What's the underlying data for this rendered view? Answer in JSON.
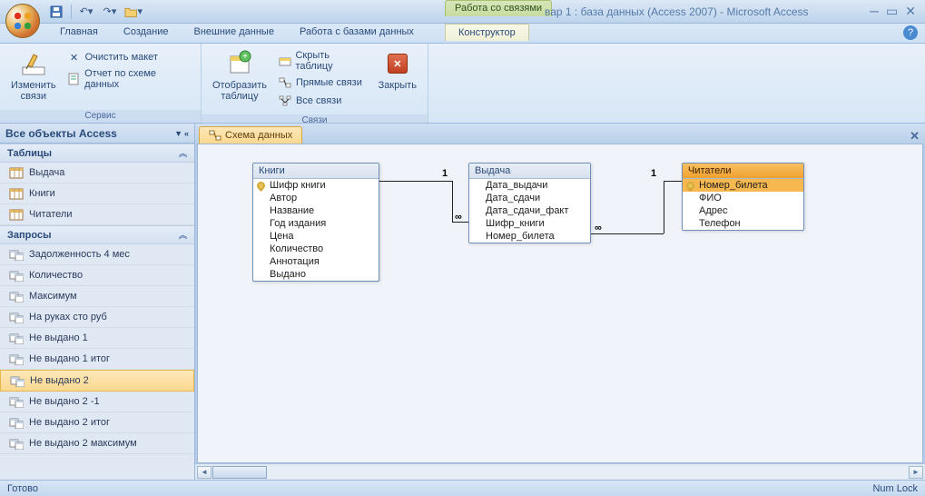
{
  "titlebar": {
    "context_label": "Работа со связями",
    "title": "вар 1 : база данных (Access 2007) - Microsoft Access"
  },
  "tabs": {
    "home": "Главная",
    "create": "Создание",
    "external": "Внешние данные",
    "dbtools": "Работа с базами данных",
    "context": "Конструктор"
  },
  "ribbon": {
    "group_service": "Сервис",
    "group_links": "Связи",
    "edit_links": "Изменить\nсвязи",
    "clear_layout": "Очистить макет",
    "report": "Отчет по схеме данных",
    "show_table": "Отобразить\nтаблицу",
    "hide_table": "Скрыть таблицу",
    "direct_links": "Прямые связи",
    "all_links": "Все связи",
    "close": "Закрыть"
  },
  "navpane": {
    "header": "Все объекты Access",
    "group_tables": "Таблицы",
    "group_queries": "Запросы",
    "tables": [
      "Выдача",
      "Книги",
      "Читатели"
    ],
    "queries": [
      "Задолженность 4 мес",
      "Количество",
      "Максимум",
      "На руках сто руб",
      "Не выдано 1",
      "Не выдано 1 итог",
      "Не выдано 2",
      "Не выдано 2 -1",
      "Не выдано 2 итог",
      "Не выдано 2 максимум"
    ],
    "selected_query": "Не выдано 2"
  },
  "doc": {
    "tab": "Схема данных"
  },
  "diagram": {
    "books": {
      "title": "Книги",
      "fields": [
        "Шифр книги",
        "Автор",
        "Название",
        "Год издания",
        "Цена",
        "Количество",
        "Аннотация",
        "Выдано"
      ],
      "pk": 0
    },
    "issue": {
      "title": "Выдача",
      "fields": [
        "Дата_выдачи",
        "Дата_сдачи",
        "Дата_сдачи_факт",
        "Шифр_книги",
        "Номер_билета"
      ]
    },
    "readers": {
      "title": "Читатели",
      "fields": [
        "Номер_билета",
        "ФИО",
        "Адрес",
        "Телефон"
      ],
      "pk": 0
    },
    "rel": {
      "one": "1",
      "many": "∞"
    }
  },
  "status": {
    "ready": "Готово",
    "numlock": "Num Lock"
  }
}
